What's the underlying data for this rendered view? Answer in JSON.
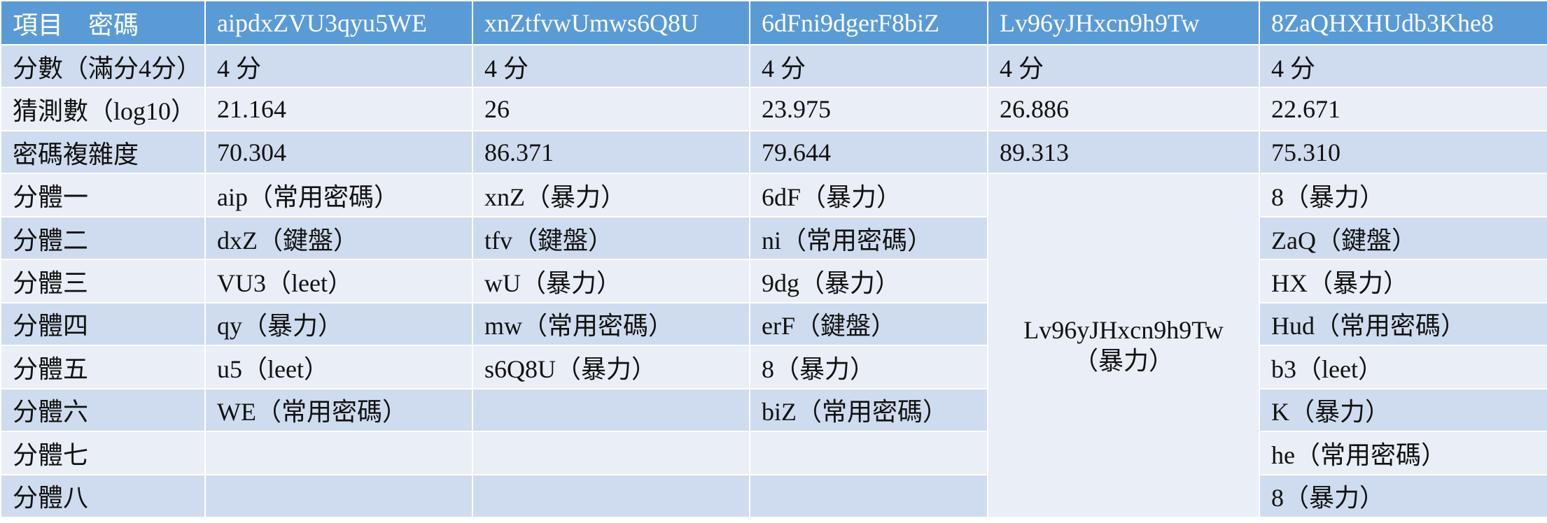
{
  "table": {
    "header": {
      "label": "項目　密碼",
      "passwords": [
        "aipdxZVU3qyu5WE",
        "xnZtfvwUmws6Q8U",
        "6dFni9dgerF8biZ",
        "Lv96yJHxcn9h9Tw",
        "8ZaQHXHUdb3Khe8"
      ]
    },
    "rows": [
      {
        "label": "分數（滿分4分）",
        "cells": [
          "4 分",
          "4 分",
          "4 分",
          "4 分",
          "4 分"
        ]
      },
      {
        "label": "猜測數（log10）",
        "cells": [
          "21.164",
          "26",
          "23.975",
          "26.886",
          "22.671"
        ]
      },
      {
        "label": "密碼複雜度",
        "cells": [
          "70.304",
          "86.371",
          "79.644",
          "89.313",
          "75.310"
        ]
      },
      {
        "label": "分體一",
        "cells": [
          "aip（常用密碼）",
          "xnZ（暴力）",
          "6dF（暴力）",
          "8（暴力）"
        ]
      },
      {
        "label": "分體二",
        "cells": [
          "dxZ（鍵盤）",
          "tfv（鍵盤）",
          "ni（常用密碼）",
          "ZaQ（鍵盤）"
        ]
      },
      {
        "label": "分體三",
        "cells": [
          "VU3（leet）",
          "wU（暴力）",
          "9dg（暴力）",
          "HX（暴力）"
        ]
      },
      {
        "label": "分體四",
        "cells": [
          "qy（暴力）",
          "mw（常用密碼）",
          "erF（鍵盤）",
          "Hud（常用密碼）"
        ]
      },
      {
        "label": "分體五",
        "cells": [
          "u5（leet）",
          "s6Q8U（暴力）",
          "8（暴力）",
          "b3（leet）"
        ]
      },
      {
        "label": "分體六",
        "cells": [
          "WE（常用密碼）",
          "",
          "biZ（常用密碼）",
          "K（暴力）"
        ]
      },
      {
        "label": "分體七",
        "cells": [
          "",
          "",
          "",
          "he（常用密碼）"
        ]
      },
      {
        "label": "分體八",
        "cells": [
          "",
          "",
          "",
          "8（暴力）"
        ]
      }
    ],
    "merged_cell": {
      "line1": "Lv96yJHxcn9h9Tw",
      "line2": "（暴力）"
    },
    "colors": {
      "header_bg": "#5b9bd5",
      "band_dark": "#cfdcef",
      "band_light": "#e9eef7"
    }
  }
}
